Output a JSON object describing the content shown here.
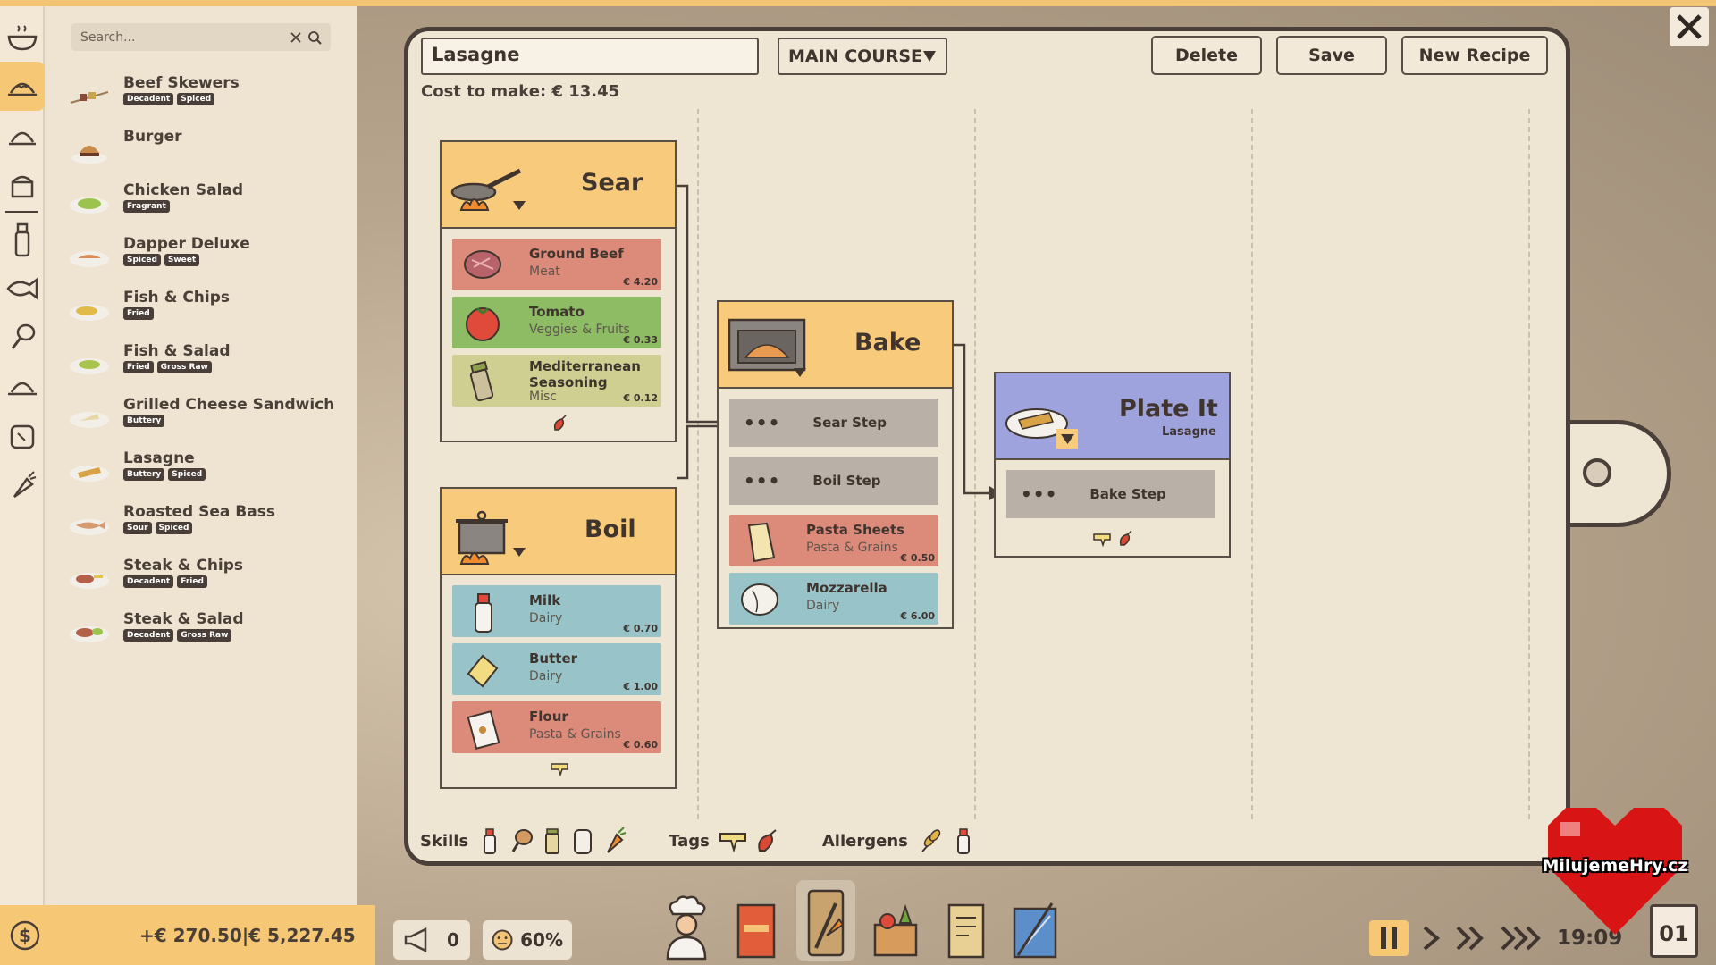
{
  "search": {
    "placeholder": "Search..."
  },
  "recipes": [
    {
      "name": "Beef Skewers",
      "tags": [
        "Decadent",
        "Spiced"
      ]
    },
    {
      "name": "Burger",
      "tags": []
    },
    {
      "name": "Chicken Salad",
      "tags": [
        "Fragrant"
      ]
    },
    {
      "name": "Dapper Deluxe",
      "tags": [
        "Spiced",
        "Sweet"
      ]
    },
    {
      "name": "Fish & Chips",
      "tags": [
        "Fried"
      ]
    },
    {
      "name": "Fish & Salad",
      "tags": [
        "Fried",
        "Gross Raw"
      ]
    },
    {
      "name": "Grilled Cheese Sandwich",
      "tags": [
        "Buttery"
      ]
    },
    {
      "name": "Lasagne",
      "tags": [
        "Buttery",
        "Spiced"
      ]
    },
    {
      "name": "Roasted Sea Bass",
      "tags": [
        "Sour",
        "Spiced"
      ]
    },
    {
      "name": "Steak & Chips",
      "tags": [
        "Decadent",
        "Fried"
      ]
    },
    {
      "name": "Steak & Salad",
      "tags": [
        "Decadent",
        "Gross Raw"
      ]
    }
  ],
  "money": {
    "text": "+€ 270.50|€ 5,227.45"
  },
  "editor": {
    "recipe_name": "Lasagne",
    "course": "MAIN COURSE",
    "delete_label": "Delete",
    "save_label": "Save",
    "new_label": "New Recipe",
    "cost": "Cost to make: € 13.45"
  },
  "steps": {
    "sear": {
      "title": "Sear",
      "ingredients": [
        {
          "name": "Ground Beef",
          "category": "Meat",
          "price": "€ 4.20"
        },
        {
          "name": "Tomato",
          "category": "Veggies & Fruits",
          "price": "€ 0.33"
        },
        {
          "name": "Mediterranean Seasoning",
          "category": "Misc",
          "price": "€ 0.12"
        }
      ]
    },
    "boil": {
      "title": "Boil",
      "ingredients": [
        {
          "name": "Milk",
          "category": "Dairy",
          "price": "€ 0.70"
        },
        {
          "name": "Butter",
          "category": "Dairy",
          "price": "€ 1.00"
        },
        {
          "name": "Flour",
          "category": "Pasta & Grains",
          "price": "€ 0.60"
        }
      ]
    },
    "bake": {
      "title": "Bake",
      "refs": [
        "Sear Step",
        "Boil Step"
      ],
      "ingredients": [
        {
          "name": "Pasta Sheets",
          "category": "Pasta & Grains",
          "price": "€ 0.50"
        },
        {
          "name": "Mozzarella",
          "category": "Dairy",
          "price": "€ 6.00"
        }
      ]
    },
    "plate": {
      "title": "Plate It",
      "subtitle": "Lasagne",
      "refs": [
        "Bake Step"
      ]
    }
  },
  "info": {
    "skills": "Skills",
    "tags": "Tags",
    "allergens": "Allergens"
  },
  "hud": {
    "marketing": "0",
    "satisfaction": "60%",
    "time": "19:09",
    "day": "01"
  },
  "watermark": "MilujemeHry.cz",
  "colors": {
    "accent": "#f6c774",
    "board": "#efe5d3",
    "outline": "#4a4039"
  }
}
